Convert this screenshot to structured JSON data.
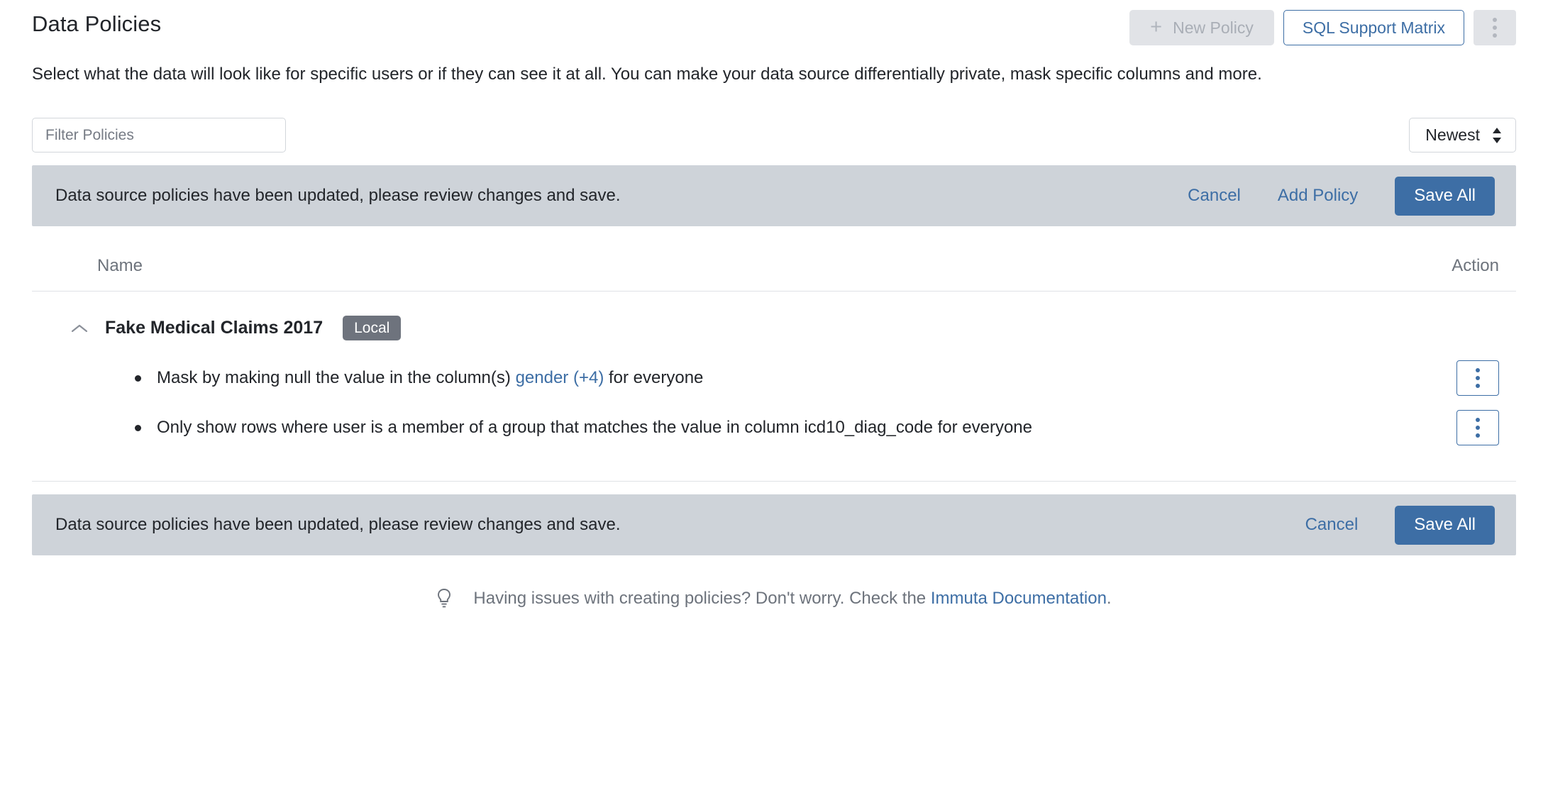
{
  "header": {
    "title": "Data Policies",
    "new_policy_label": "New Policy",
    "new_policy_icon": "plus-icon",
    "sql_matrix_label": "SQL Support Matrix",
    "overflow_icon": "kebab-vertical-icon"
  },
  "description": "Select what the data will look like for specific users or if they can see it at all. You can make your data source differentially private, mask specific columns and more.",
  "filter": {
    "placeholder": "Filter Policies",
    "value": ""
  },
  "sort": {
    "selected": "Newest",
    "icon": "chevron-up-down-icon"
  },
  "banner_top": {
    "message": "Data source policies have been updated, please review changes and save.",
    "cancel_label": "Cancel",
    "add_policy_label": "Add Policy",
    "save_all_label": "Save All"
  },
  "table": {
    "columns": {
      "name": "Name",
      "action": "Action"
    },
    "groups": [
      {
        "name": "Fake Medical Claims 2017",
        "badge": "Local",
        "expanded": true,
        "collapse_icon": "chevron-up-icon",
        "policies": [
          {
            "text_before": "Mask by making null the value in the column(s)",
            "link_text": "gender (+4)",
            "text_after": "for everyone",
            "action_icon": "kebab-vertical-icon"
          },
          {
            "text_before": "Only show rows where user is a member of a group that matches the value in column icd10_diag_code for everyone",
            "link_text": "",
            "text_after": "",
            "action_icon": "kebab-vertical-icon"
          }
        ]
      }
    ]
  },
  "banner_bottom": {
    "message": "Data source policies have been updated, please review changes and save.",
    "cancel_label": "Cancel",
    "save_all_label": "Save All"
  },
  "footer": {
    "icon": "lightbulb-icon",
    "text": "Having issues with creating policies? Don't worry. Check the",
    "link_text": "Immuta Documentation",
    "text_end": "."
  },
  "colors": {
    "accent_blue": "#3d6ea5",
    "banner_grey": "#ced3d9",
    "badge_grey": "#6e737d",
    "disabled_grey": "#e1e3e7",
    "muted_text": "#6d737c"
  }
}
